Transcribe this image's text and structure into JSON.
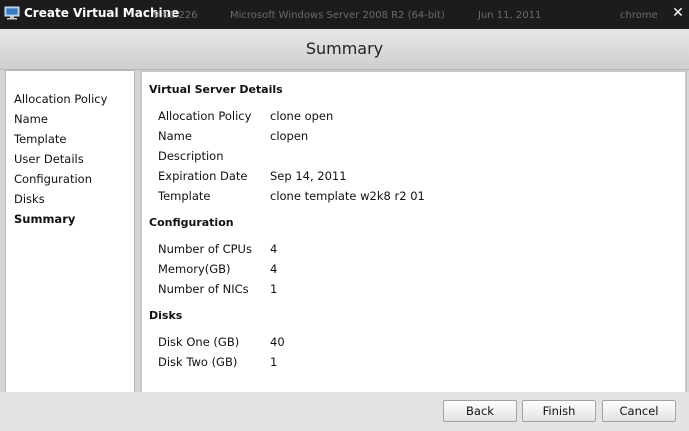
{
  "window": {
    "title": "Create Virtual Machine",
    "background_text": [
      "9.61.226",
      "Microsoft Windows Server 2008 R2 (64-bit)",
      "Jun 11, 2011",
      "chrome"
    ],
    "close_icon": "close-icon",
    "app_icon": "computer-icon"
  },
  "header": {
    "title": "Summary"
  },
  "nav": {
    "items": [
      {
        "label": "Allocation Policy"
      },
      {
        "label": "Name"
      },
      {
        "label": "Template"
      },
      {
        "label": "User Details"
      },
      {
        "label": "Configuration"
      },
      {
        "label": "Disks"
      },
      {
        "label": "Summary",
        "active": true
      }
    ]
  },
  "summary": {
    "virtual_server": {
      "heading": "Virtual Server Details",
      "rows": [
        {
          "label": "Allocation Policy",
          "value": "clone open"
        },
        {
          "label": "Name",
          "value": "clopen"
        },
        {
          "label": "Description",
          "value": ""
        },
        {
          "label": "Expiration Date",
          "value": "Sep 14, 2011"
        },
        {
          "label": "Template",
          "value": "clone template w2k8 r2 01"
        }
      ]
    },
    "configuration": {
      "heading": "Configuration",
      "rows": [
        {
          "label": "Number of CPUs",
          "value": "4"
        },
        {
          "label": "Memory(GB)",
          "value": "4"
        },
        {
          "label": "Number of NICs",
          "value": "1"
        }
      ]
    },
    "disks": {
      "heading": "Disks",
      "rows": [
        {
          "label": "Disk One (GB)",
          "value": "40"
        },
        {
          "label": "Disk Two (GB)",
          "value": "1"
        }
      ]
    }
  },
  "buttons": {
    "back": "Back",
    "finish": "Finish",
    "cancel": "Cancel"
  },
  "colors": {
    "titlebar": "#1c1c1c",
    "panel": "#ffffff",
    "chrome": "#d6d6d6"
  }
}
